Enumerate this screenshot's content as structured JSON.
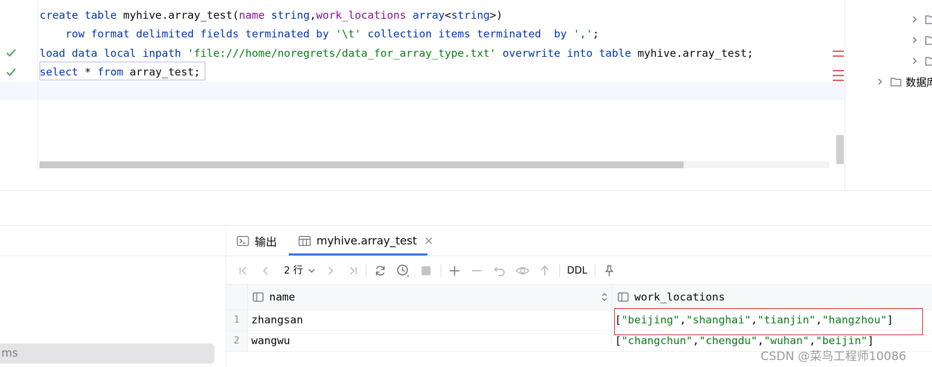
{
  "editor": {
    "lines": [
      {
        "parts": [
          {
            "t": "create table ",
            "c": "kw"
          },
          {
            "t": "myhive.array_test(",
            "c": ""
          },
          {
            "t": "name",
            "c": "fn"
          },
          {
            "t": " ",
            "c": ""
          },
          {
            "t": "string",
            "c": "kw"
          },
          {
            "t": ",",
            "c": ""
          },
          {
            "t": "work_locations",
            "c": "fn"
          },
          {
            "t": " ",
            "c": ""
          },
          {
            "t": "array",
            "c": "kw"
          },
          {
            "t": "<",
            "c": ""
          },
          {
            "t": "string",
            "c": "kw"
          },
          {
            "t": ">)",
            "c": ""
          }
        ]
      },
      {
        "parts": [
          {
            "t": "    row format delimited fields terminated by ",
            "c": "kw"
          },
          {
            "t": "'\\t'",
            "c": "str"
          },
          {
            "t": " collection items terminated  by ",
            "c": "kw"
          },
          {
            "t": "','",
            "c": "str"
          },
          {
            "t": ";",
            "c": ""
          }
        ]
      },
      {
        "parts": [
          {
            "t": "load data local inpath ",
            "c": "kw"
          },
          {
            "t": "'file:///home/noregrets/data_for_array_type.txt'",
            "c": "str"
          },
          {
            "t": " overwrite into table ",
            "c": "kw"
          },
          {
            "t": "myhive.array_test;",
            "c": ""
          }
        ]
      },
      {
        "parts": [
          {
            "t": "select",
            "c": "kw"
          },
          {
            "t": " * ",
            "c": ""
          },
          {
            "t": "from",
            "c": "kw"
          },
          {
            "t": " array_test;",
            "c": ""
          }
        ]
      }
    ]
  },
  "tree": {
    "last_folder_label": "数据库"
  },
  "services": {
    "item_label": "ms"
  },
  "results": {
    "tabs": [
      {
        "label": "输出",
        "icon": "console-icon"
      },
      {
        "label": "myhive.array_test",
        "icon": "table-icon",
        "close": "×"
      }
    ],
    "toolbar": {
      "row_count": "2 行",
      "ddl_label": "DDL"
    },
    "columns": [
      "name",
      "work_locations"
    ],
    "rows": [
      {
        "num": "1",
        "name": "zhangsan",
        "work_locations": [
          "beijing",
          "shanghai",
          "tianjin",
          "hangzhou"
        ]
      },
      {
        "num": "2",
        "name": "wangwu",
        "work_locations": [
          "changchun",
          "chengdu",
          "wuhan",
          "beijin"
        ]
      }
    ]
  },
  "watermark": "CSDN @菜鸟工程师10086",
  "colors": {
    "keyword": "#0033b3",
    "identifier": "#871094",
    "string": "#067d17",
    "check": "#4aa35a",
    "highlight_box": "#e03030"
  }
}
